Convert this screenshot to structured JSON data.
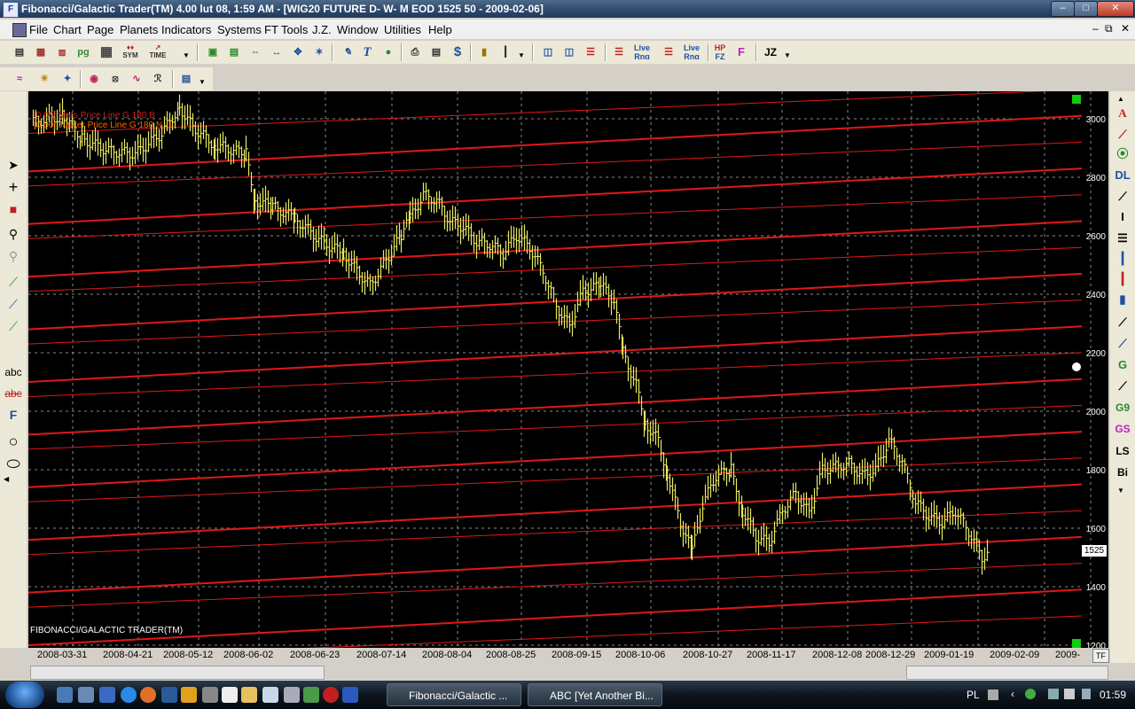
{
  "window": {
    "title": "Fibonacci/Galactic Trader(TM) 4.00 lut 08,  1:59 AM - [WIG20 FUTURE D- W- M EOD  1525     50 - 2009-02-06]",
    "app_icon_letter": "F"
  },
  "menubar": {
    "items": [
      "File",
      "Chart",
      "Page",
      "Planets",
      "Indicators",
      "Systems",
      "FT Tools",
      "J.Z.",
      "Window",
      "Utilities",
      "Help"
    ]
  },
  "toolbar1": {
    "sym_label": "SYM",
    "time_label": "TIME",
    "pg_label": "pg",
    "live_rng_label_a": "Live",
    "live_rng_label_b": "Rng",
    "hp_label": "HP",
    "fz_label": "FZ",
    "jz_label": "JZ"
  },
  "chart": {
    "legend": [
      {
        "text": "[0.00] Mars Price Line G 180 B",
        "color": "#cc2020"
      },
      {
        "text": "[0.00] Jupiter Price Line G 180 N -1",
        "color": "#ff6600"
      }
    ],
    "watermark": "FIBONACCI/GALACTIC TRADER(TM)",
    "last_price": "1525",
    "price_ticks": [
      "3000",
      "2800",
      "2600",
      "2400",
      "2200",
      "2000",
      "1800",
      "1600",
      "1400",
      "1200"
    ],
    "date_ticks": [
      "2008-03-31",
      "2008-04-21",
      "2008-05-12",
      "2008-06-02",
      "2008-06-23",
      "2008-07-14",
      "2008-08-04",
      "2008-08-25",
      "2008-09-15",
      "2008-10-06",
      "2008-10-27",
      "2008-11-17",
      "2008-12-08",
      "2008-12-29",
      "2009-01-19",
      "2009-02-09",
      "2009-"
    ],
    "tf_button": "TF",
    "colors": {
      "bars": "#e8e860",
      "planet_lines": "#e01818",
      "grid": "#8a8a8a",
      "background": "#000000"
    }
  },
  "left_toolbar": {
    "abc_label": "abc",
    "f_label": "F"
  },
  "right_toolbar": {
    "items": [
      "A",
      "DL",
      "I",
      "G9",
      "GS",
      "LS",
      "Bi"
    ]
  },
  "taskbar": {
    "tasks": [
      "Fibonacci/Galactic ...",
      "ABC [Yet Another Bi..."
    ],
    "language": "PL",
    "clock": "01:59"
  }
}
